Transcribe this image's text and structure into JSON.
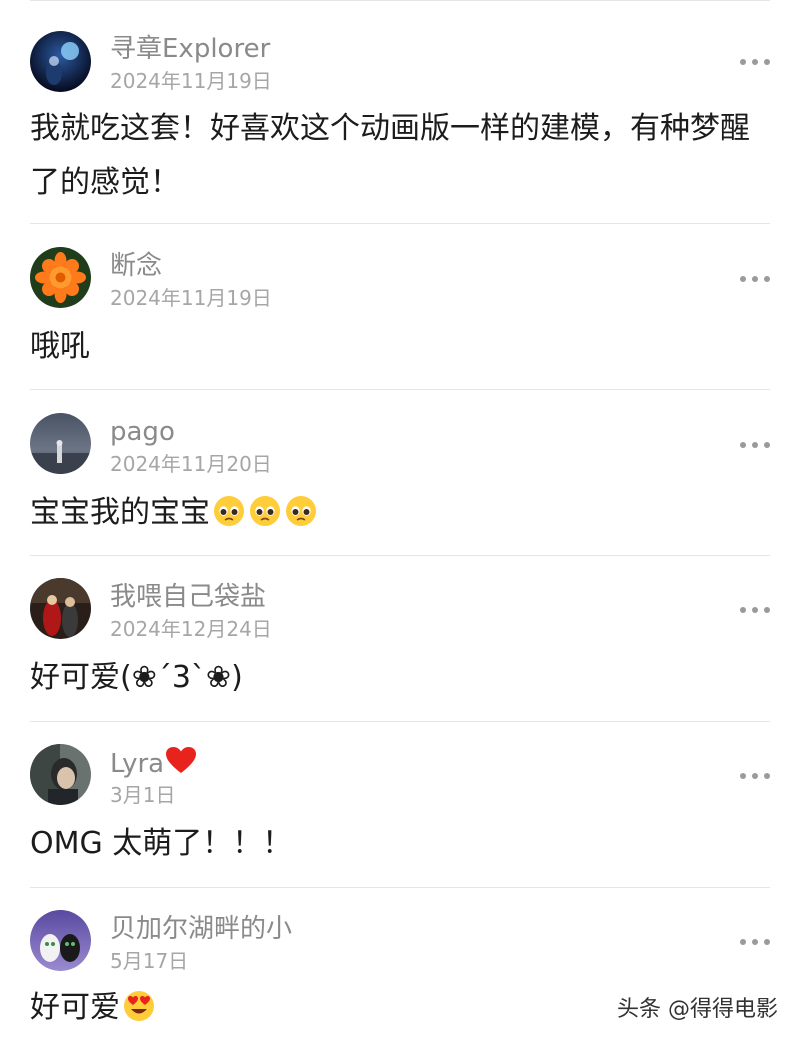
{
  "comments": [
    {
      "username": "寻章Explorer",
      "date": "2024年11月19日",
      "text": "我就吃这套！好喜欢这个动画版一样的建模，有种梦醒了的感觉！"
    },
    {
      "username": "断念",
      "date": "2024年11月19日",
      "text": "哦吼"
    },
    {
      "username": "pago",
      "date": "2024年11月20日",
      "text": "宝宝我的宝宝"
    },
    {
      "username": "我喂自己袋盐",
      "date": "2024年12月24日",
      "text": "好可爱(❀´3`❀)"
    },
    {
      "username": "Lyra",
      "date": "3月1日",
      "text": "OMG 太萌了！！！"
    },
    {
      "username": "贝加尔湖畔的小",
      "date": "5月17日",
      "text": "好可爱"
    }
  ],
  "icons": {
    "more": "more-options-icon",
    "heart": "red-heart-emoji",
    "pleading": "pleading-face-emoji",
    "heart_eyes": "heart-eyes-emoji"
  },
  "watermark": "头条 @得得电影"
}
